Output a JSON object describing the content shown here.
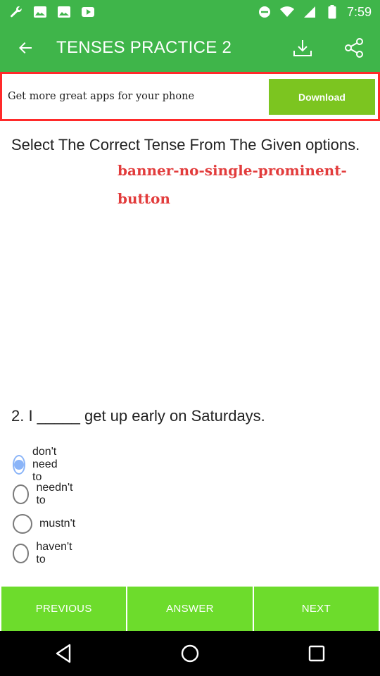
{
  "status_bar": {
    "time": "7:59",
    "icons_left": [
      "wrench-icon",
      "image-icon",
      "image-icon",
      "play-icon"
    ],
    "icons_right": [
      "dnd-icon",
      "wifi-icon",
      "signal-icon",
      "battery-icon"
    ]
  },
  "app_bar": {
    "title": "TENSES PRACTICE 2",
    "back_icon": "arrow-back-icon",
    "actions": [
      "download-icon",
      "share-icon"
    ]
  },
  "ad_banner": {
    "text": "Get more great apps for your phone",
    "button_label": "Download"
  },
  "question": {
    "instruction": "Select The Correct Tense From The Given options.",
    "placeholder_label": "banner-no-single-prominent-button",
    "prompt": "2. I _____ get up early on Saturdays.",
    "options": [
      {
        "label": "don't need to",
        "selected": true
      },
      {
        "label": "needn't to",
        "selected": false
      },
      {
        "label": "mustn't",
        "selected": false
      },
      {
        "label": "haven't to",
        "selected": false
      }
    ]
  },
  "bottom_bar": {
    "previous_label": "PREVIOUS",
    "answer_label": "ANSWER",
    "next_label": "NEXT"
  },
  "colors": {
    "primary": "#3fb54a",
    "bottom_button": "#6ddc2c",
    "ad_button": "#7cc520",
    "ad_border": "#ff2a2a",
    "placeholder_text": "#e23c3c",
    "radio_selected": "#8ab4f8"
  }
}
